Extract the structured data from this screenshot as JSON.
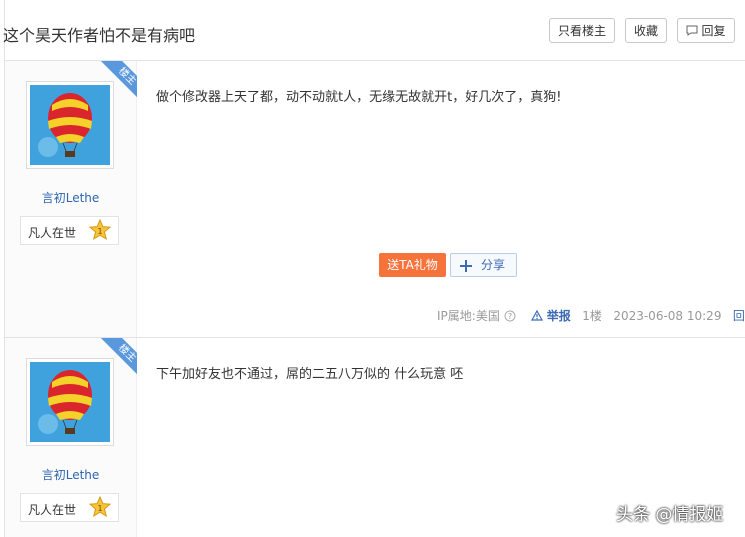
{
  "thread": {
    "title": "这个昊天作者怕不是有病吧",
    "buttons": {
      "only_op": "只看楼主",
      "favorite": "收藏",
      "reply": "回复"
    }
  },
  "posts": [
    {
      "badge": "楼主",
      "username": "言初Lethe",
      "level_title": "凡人在世",
      "level": "1",
      "content": "做个修改器上天了都，动不动就t人，无缘无故就开t，好几次了，真狗!",
      "gift_label": "送TA礼物",
      "share_label": "分享",
      "ip_location": "IP属地:美国",
      "report_label": "举报",
      "floor": "1楼",
      "timestamp": "2023-06-08 10:29",
      "reply_label": "回复"
    },
    {
      "badge": "楼主",
      "username": "言初Lethe",
      "level_title": "凡人在世",
      "level": "1",
      "content": "下午加好友也不通过，屌的二五八万似的 什么玩意 呸"
    }
  ],
  "watermark": "头条 @情报姬",
  "colors": {
    "link": "#2d64b3",
    "gift": "#f7733c",
    "ribbon": "#5a98de"
  }
}
